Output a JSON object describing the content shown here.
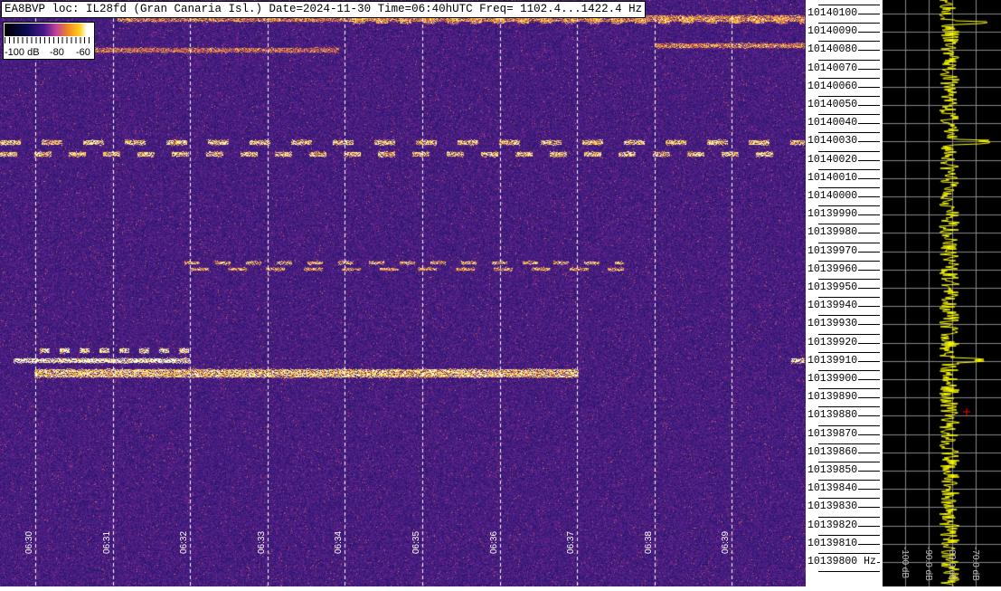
{
  "header": {
    "text": "EA8BVP loc: IL28fd (Gran Canaria Isl.) Date=2024-11-30 Time=06:40hUTC Freq= 1102.4...1422.4 Hz"
  },
  "legend": {
    "labels": [
      "-100 dB",
      "-80",
      "-60"
    ]
  },
  "time_labels": [
    "06:30",
    "06:31",
    "06:32",
    "06:33",
    "06:34",
    "06:35",
    "06:36",
    "06:37",
    "06:38",
    "06:39"
  ],
  "freq_labels": [
    "10140100",
    "10140090",
    "10140080",
    "10140070",
    "10140060",
    "10140050",
    "10140040",
    "10140030",
    "10140020",
    "10140010",
    "10140000",
    "10139990",
    "10139980",
    "10139970",
    "10139960",
    "10139950",
    "10139940",
    "10139930",
    "10139920",
    "10139910",
    "10139900",
    "10139890",
    "10139880",
    "10139870",
    "10139860",
    "10139850",
    "10139840",
    "10139830",
    "10139820",
    "10139810",
    "10139800 Hz"
  ],
  "spectrum": {
    "db_labels": [
      "-100 dB",
      "-90.0 dB",
      "-80.0 dB",
      "-70.0 dB"
    ],
    "trace_color": "#ffff00"
  },
  "colors": {
    "background": "#3a1a80",
    "signal": "#ffc020"
  }
}
